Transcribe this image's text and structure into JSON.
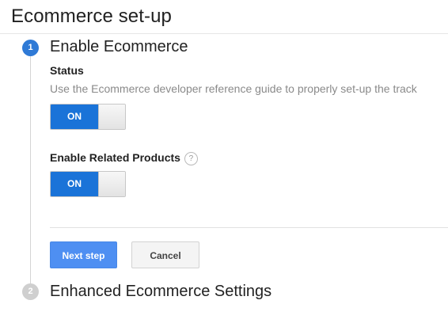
{
  "page": {
    "title": "Ecommerce set-up"
  },
  "steps": [
    {
      "number": "1",
      "title": "Enable Ecommerce",
      "state": "active"
    },
    {
      "number": "2",
      "title": "Enhanced Ecommerce Settings",
      "state": "inactive"
    }
  ],
  "step1": {
    "status_label": "Status",
    "status_help": "Use the Ecommerce developer reference guide to properly set-up the track",
    "status_toggle": "ON",
    "related_label": "Enable Related Products",
    "help_icon": "?",
    "related_toggle": "ON",
    "next_button": "Next step",
    "cancel_button": "Cancel"
  },
  "colors": {
    "accent": "#1a73d8",
    "step_active": "#2f7ad6",
    "step_inactive": "#cfcfcf",
    "button_primary": "#4e8ff2"
  },
  "icons": {
    "help": "question-circle-icon"
  }
}
